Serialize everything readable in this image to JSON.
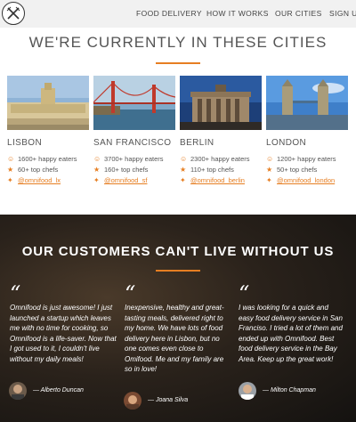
{
  "nav": {
    "logo_icon": "fork-knife-icon",
    "links": [
      "FOOD DELIVERY",
      "HOW IT WORKS",
      "OUR CITIES",
      "SIGN UP"
    ]
  },
  "cities_section": {
    "title": "WE'RE CURRENTLY IN THESE CITIES",
    "accent_color": "#e67e22",
    "cities": [
      {
        "name": "LISBON",
        "eaters": "1600+ happy eaters",
        "chefs": "60+ top chefs",
        "twitter": "@omnifood_lx"
      },
      {
        "name": "SAN FRANCISCO",
        "eaters": "3700+ happy eaters",
        "chefs": "160+ top chefs",
        "twitter": "@omnifood_sf"
      },
      {
        "name": "BERLIN",
        "eaters": "2300+ happy eaters",
        "chefs": "110+ top chefs",
        "twitter": "@omnifood_berlin"
      },
      {
        "name": "LONDON",
        "eaters": "1200+ happy eaters",
        "chefs": "50+ top chefs",
        "twitter": "@omnifood_london"
      }
    ]
  },
  "testimonials": {
    "title": "OUR CUSTOMERS CAN'T LIVE WITHOUT US",
    "quote_mark": "“",
    "items": [
      {
        "text": "Omnifood is just awesome! I just launched a startup which leaves me with no time for cooking, so Omnifood is a life-saver. Now that I got used to it, I couldn't live without my daily meals!",
        "author": "— Alberto Duncan"
      },
      {
        "text": "Inexpensive, healthy and great-tasting meals, delivered right to my home. We have lots of food delivery here in Lisbon, but no one comes even close to Omifood. Me and my family are so in love!",
        "author": "— Joana Silva"
      },
      {
        "text": "I was looking for a quick and easy food delivery service in San Franciso. I tried a lot of them and ended up with Omnifood. Best food delivery service in the Bay Area. Keep up the great work!",
        "author": "— Milton Chapman"
      }
    ]
  }
}
